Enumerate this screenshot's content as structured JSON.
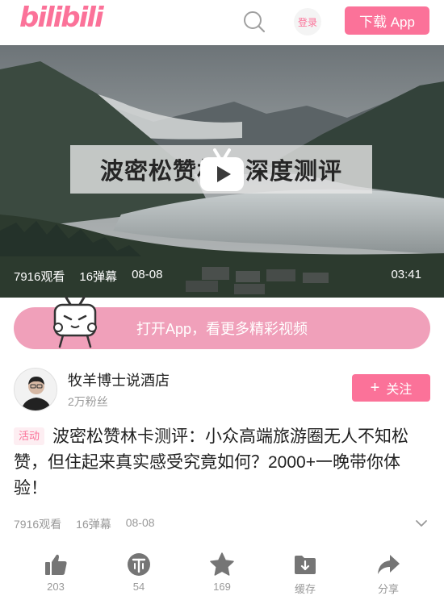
{
  "header": {
    "logo": "bilibili",
    "login_label": "登录",
    "download_label": "下载 App"
  },
  "video": {
    "caption": "波密松赞林卡深度测评",
    "views": "7916观看",
    "danmaku": "16弹幕",
    "date": "08-08",
    "duration": "03:41"
  },
  "banner": {
    "open_app": "打开App，看更多精彩视频"
  },
  "uploader": {
    "name": "牧羊博士说酒店",
    "fans": "2万粉丝",
    "follow_label": "关注"
  },
  "content": {
    "tag": "活动",
    "title": "波密松赞林卡测评：小众高端旅游圈无人不知松赞，但住起来真实感受究竟如何？2000+一晚带你体验！",
    "views": "7916观看",
    "danmaku": "16弹幕",
    "date": "08-08"
  },
  "actions": {
    "like": "203",
    "coin": "54",
    "favorite": "169",
    "cache": "缓存",
    "share": "分享"
  },
  "colors": {
    "brand": "#fb7299",
    "banner": "#f0a0ba",
    "icon_gray": "#757575"
  }
}
